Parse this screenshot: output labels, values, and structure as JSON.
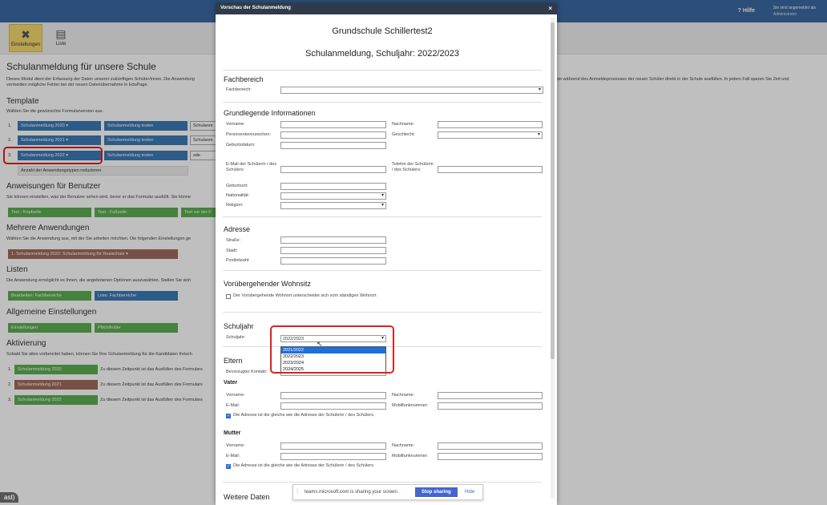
{
  "topbar": {
    "help": "Hilfe",
    "user_line1": "Sie sind angemeldet als",
    "user_line2": "Administrator"
  },
  "toolbar": {
    "settings": "Einstellungen",
    "list": "Liste"
  },
  "page": {
    "title": "Schulanmeldung für unsere Schule",
    "intro1": "Dieses Modul dient der Erfassung der Daten unserer zukünftigen Schüler/innen. Die Anwendung",
    "intro2": "vermeiden mögliche Fehler bei der neuen Datenübernahme in EduPage.",
    "intro_right": "sie während des Anmeldeprozesses der neuen Schüler direkt in der Schule ausfüllen. In jedem Fall sparen Sie Zeit und",
    "template_title": "Template",
    "template_desc": "Wählen Sie die gewünschte Formularversion aus.",
    "templates": [
      {
        "num": "1.",
        "name": "Schulanmeldung 2020",
        "test": "Schulanmeldung testen",
        "field": "Schulanm"
      },
      {
        "num": "2.",
        "name": "Schulanmeldung 2021",
        "test": "Schulanmeldung testen",
        "field": "Schulanm"
      },
      {
        "num": "3.",
        "name": "Schulanmeldung 2022",
        "test": "Schulanmeldung testen",
        "field": "sde"
      }
    ],
    "reduce": "Anzahl der Anwendungstypen reduzieren",
    "instr_title": "Anweisungen für Benutzer",
    "instr_desc": "Sie können einstellen, was der Benutzer sehen wird, bevor er das Formular ausfüllt. Sie könne",
    "instr_btns": [
      "Text - Kopfzeile",
      "Text - Fußzeile",
      "Text vor der F"
    ],
    "multi_title": "Mehrere Anwendungen",
    "multi_desc": "Wählen Sie die Anwendung aus, mit der Sie arbeiten möchten. Die folgenden Einstellungen ge",
    "multi_select": "1. Schulanmeldung 2020: Schulanmeldung für Realschule",
    "lists_title": "Listen",
    "lists_desc": "Die Anwendung ermöglicht es Ihnen, die angebotenen Optionen auszuwählen. Stellen Sie sich",
    "lists_btns": [
      "Bearbeiten: Fachbereiche",
      "Liste: Fachbereiche"
    ],
    "general_title": "Allgemeine Einstellungen",
    "general_btns": [
      "Einstellungen",
      "Pflichtfelder"
    ],
    "activation_title": "Aktivierung",
    "activation_desc": "Sobald Sie alles vorbereitet haben, können Sie Ihre Schulanmeldung für die Kandidaten freisch",
    "activation": [
      {
        "num": "1.",
        "name": "Schulanmeldung 2020",
        "text": "Zu diesem Zeitpunkt ist das Ausfüllen des Formulars"
      },
      {
        "num": "2.",
        "name": "Schulanmeldung 2021",
        "text": "Zu diesem Zeitpunkt ist das Ausfüllen des Formulars"
      },
      {
        "num": "3.",
        "name": "Schulanmeldung 2022",
        "text": "Zu diesem Zeitpunkt ist das Ausfüllen des Formulars"
      }
    ]
  },
  "modal": {
    "header": "Vorschau der Schulanmeldung",
    "school": "Grundschule Schillertest2",
    "subtitle": "Schulanmeldung, Schuljahr: 2022/2023",
    "fachbereich": {
      "title": "Fachbereich",
      "label": "Fachbereich:"
    },
    "basic": {
      "title": "Grundlegende Informationen",
      "vorname": "Vorname:",
      "nachname": "Nachname:",
      "pkz": "Personenkennzeichen:",
      "geschlecht": "Geschlecht:",
      "geburtsdatum": "Geburtsdatum:",
      "email": "E-Mail der Schülerin / des Schülers:",
      "telefon": "Telefon der Schülerin / des Schülers:",
      "geburtsort": "Geburtsort:",
      "nationalitaet": "Nationalität:",
      "religion": "Religion:"
    },
    "address": {
      "title": "Adresse",
      "strasse": "Straße:",
      "stadt": "Stadt:",
      "plz": "Postleitzahl:"
    },
    "temp": {
      "title": "Vorübergehender Wohnsitz",
      "checkbox": "Der Vorübergehende Wohnort unterscheidet sich vom ständigen Wohnort"
    },
    "schuljahr": {
      "title": "Schuljahr",
      "label": "Schuljahr:",
      "selected": "2022/2023",
      "options": [
        "2021/2022",
        "2022/2023",
        "2023/2024",
        "2024/2025"
      ],
      "highlighted": "2021/2022"
    },
    "eltern": {
      "title": "Eltern",
      "kontakt": "Bevorzugter Kontakt:",
      "vater": "Vater",
      "mutter": "Mutter",
      "vorname": "Vorname:",
      "nachname": "Nachname:",
      "email": "E-Mail:",
      "mobil": "Mobilfunknummer:",
      "same_address": "Die Adresse ist die gleiche wie die Adresse der Schülerin / des Schülers."
    },
    "weitere": "Weitere Daten"
  },
  "teams": {
    "text": "teams.microsoft.com is sharing your screen.",
    "stop": "Stop sharing",
    "hide": "Hide"
  },
  "corner_label": "ast)"
}
